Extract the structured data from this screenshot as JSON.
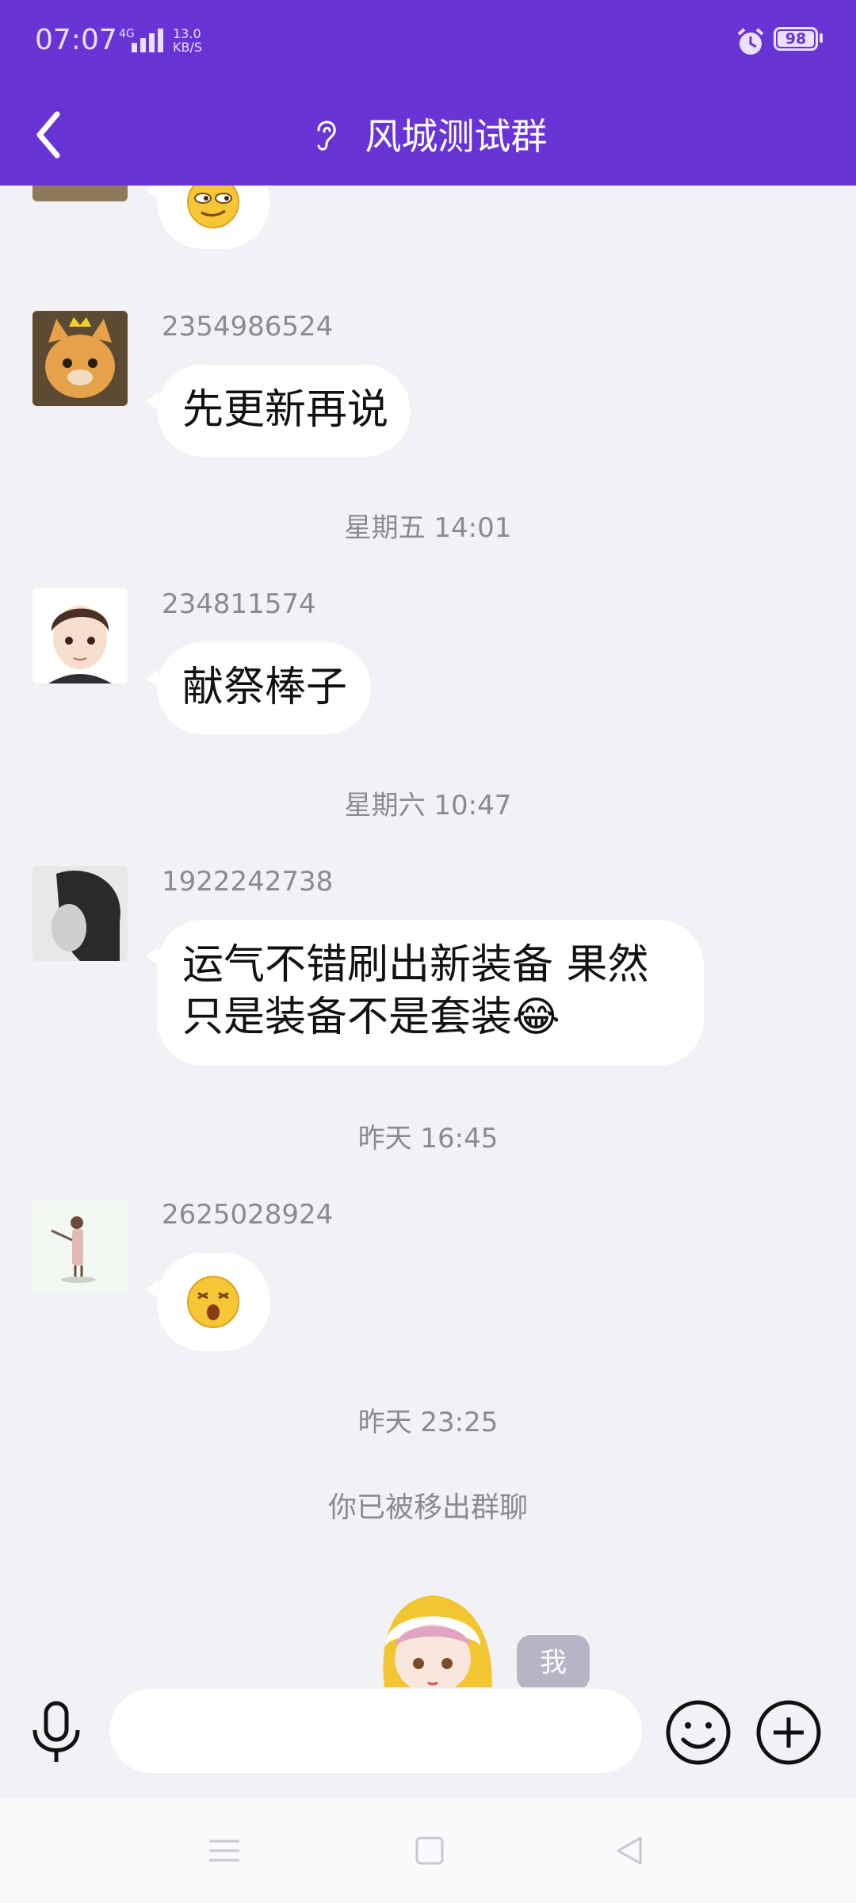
{
  "status": {
    "time": "07:07",
    "network": "4G",
    "speed_value": "13.0",
    "speed_unit": "KB/S",
    "battery": "98"
  },
  "header": {
    "title": "风城测试群",
    "back_icon": "back-arrow-icon",
    "mode_icon": "earpiece-icon"
  },
  "messages": [
    {
      "type": "emoji",
      "sender": "",
      "emoji": "smug-face"
    },
    {
      "type": "text",
      "sender": "2354986524",
      "text": "先更新再说"
    },
    {
      "type": "time",
      "text": "星期五 14:01"
    },
    {
      "type": "text",
      "sender": "234811574",
      "text": "献祭棒子"
    },
    {
      "type": "time",
      "text": "星期六 10:47"
    },
    {
      "type": "text",
      "sender": "1922242738",
      "lines": [
        "运气不错刷出新装备 果然",
        "只是装备不是套装😂"
      ]
    },
    {
      "type": "time",
      "text": "昨天 16:45"
    },
    {
      "type": "emoji",
      "sender": "2625028924",
      "emoji": "shocked-face"
    },
    {
      "type": "time",
      "text": "昨天 23:25"
    },
    {
      "type": "system",
      "text": "你已被移出群聊"
    }
  ],
  "me_tag": "我",
  "input": {
    "placeholder": ""
  },
  "colors": {
    "brand": "#6834d6",
    "background": "#f1f1f6",
    "bubble": "#ffffff"
  }
}
